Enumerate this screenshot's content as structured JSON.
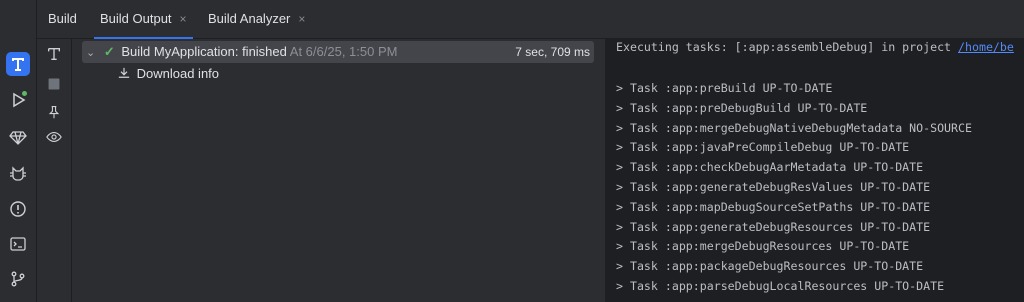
{
  "tabs": {
    "build": "Build",
    "build_output": "Build Output",
    "build_analyzer": "Build Analyzer",
    "close_glyph": "×"
  },
  "sidebar": {
    "icons": [
      "build-icon",
      "run-icon",
      "gem-icon",
      "logcat-icon",
      "problems-icon",
      "terminal-icon",
      "git-icon"
    ]
  },
  "tools": {
    "icons": [
      "text-tool-icon",
      "stop-icon",
      "pin-icon",
      "eye-icon"
    ]
  },
  "tree": {
    "build_label": "Build MyApplication:",
    "status": "finished",
    "timestamp": "At 6/6/25, 1:50 PM",
    "duration": "7 sec, 709 ms",
    "download_info": "Download info"
  },
  "console": {
    "header_prefix": "Executing tasks: [:app:assembleDebug] in project ",
    "header_link": "/home/be",
    "lines": [
      "> Task :app:preBuild UP-TO-DATE",
      "> Task :app:preDebugBuild UP-TO-DATE",
      "> Task :app:mergeDebugNativeDebugMetadata NO-SOURCE",
      "> Task :app:javaPreCompileDebug UP-TO-DATE",
      "> Task :app:checkDebugAarMetadata UP-TO-DATE",
      "> Task :app:generateDebugResValues UP-TO-DATE",
      "> Task :app:mapDebugSourceSetPaths UP-TO-DATE",
      "> Task :app:generateDebugResources UP-TO-DATE",
      "> Task :app:mergeDebugResources UP-TO-DATE",
      "> Task :app:packageDebugResources UP-TO-DATE",
      "> Task :app:parseDebugLocalResources UP-TO-DATE"
    ]
  },
  "colors": {
    "accent": "#3574f0",
    "success": "#5fb865",
    "link": "#548af7"
  }
}
